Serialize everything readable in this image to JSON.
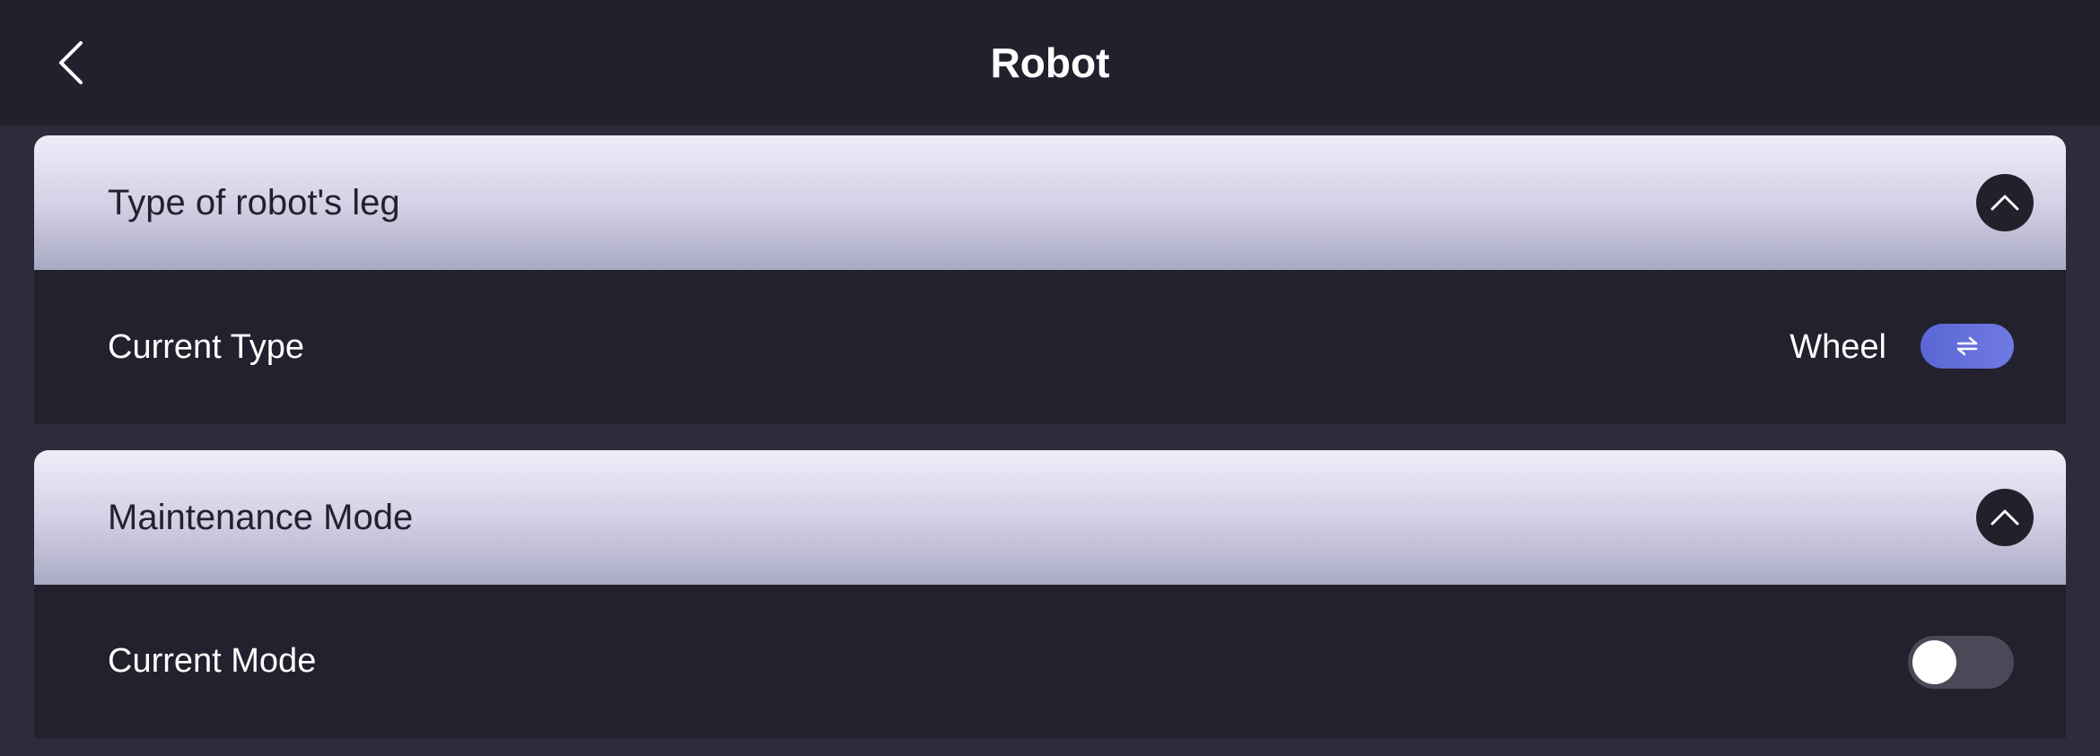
{
  "header": {
    "title": "Robot"
  },
  "sections": [
    {
      "title": "Type of robot's leg",
      "row_label": "Current Type",
      "row_value": "Wheel"
    },
    {
      "title": "Maintenance Mode",
      "row_label": "Current Mode",
      "toggle_on": false
    }
  ],
  "colors": {
    "accent": "#5a66d4",
    "background": "#21212d"
  }
}
